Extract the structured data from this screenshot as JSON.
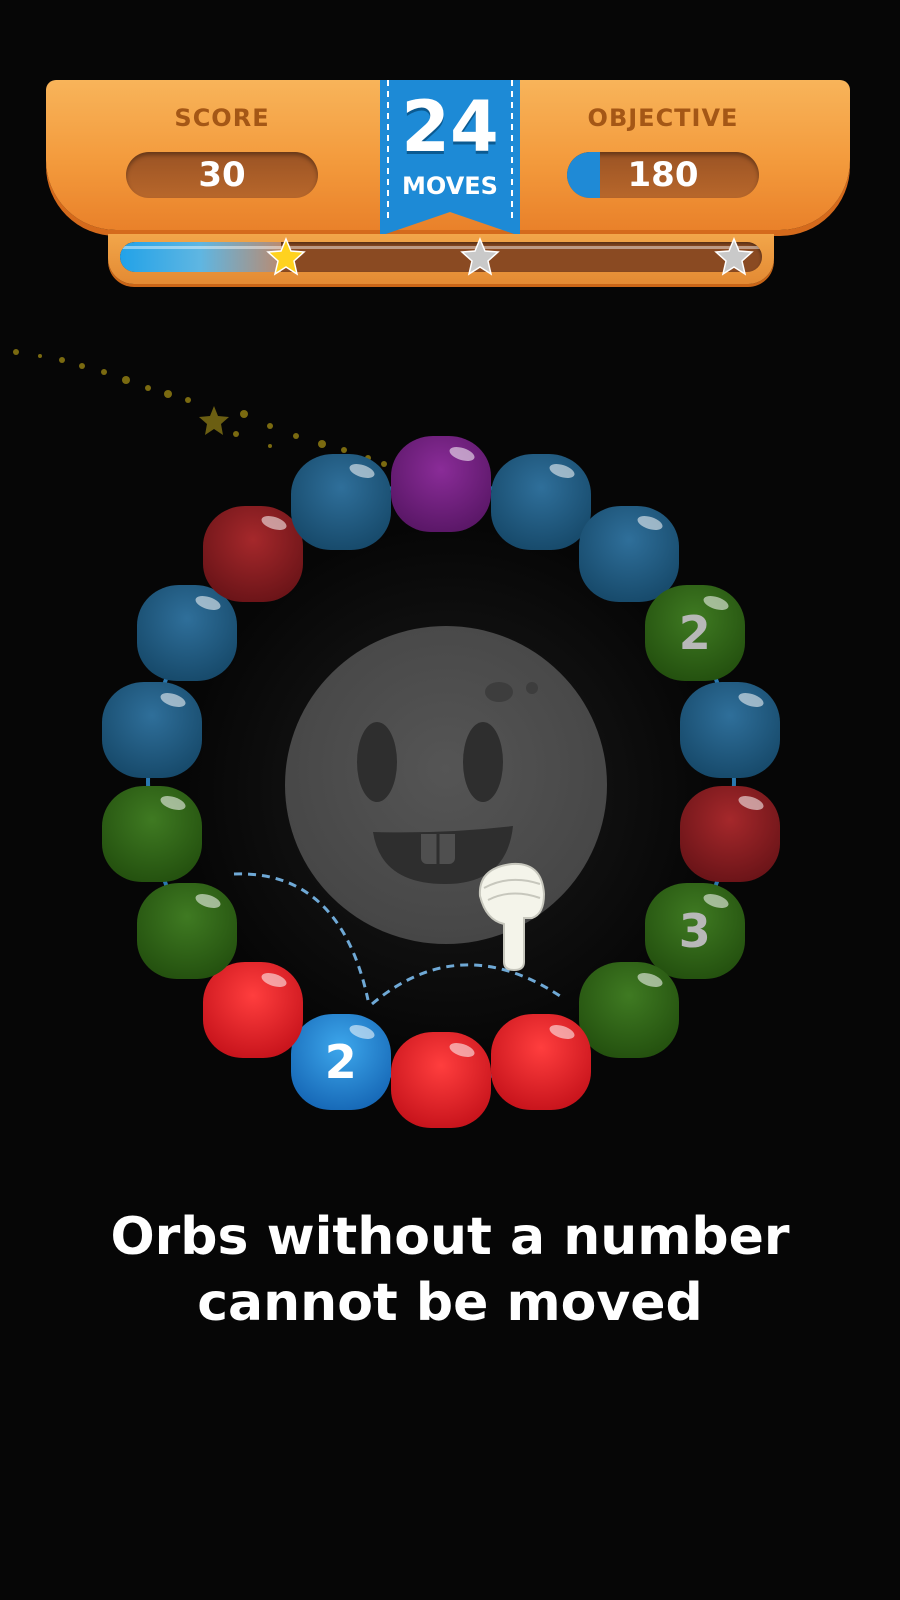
{
  "hud": {
    "score_label": "SCORE",
    "score_value": "30",
    "moves_count": "24",
    "moves_label": "MOVES",
    "objective_label": "OBJECTIVE",
    "objective_value": "180",
    "objective_progress": 0.17,
    "star_progress": 0.25,
    "stars": [
      {
        "name": "star-1",
        "earned": true
      },
      {
        "name": "star-2",
        "earned": false
      },
      {
        "name": "star-3",
        "earned": false
      }
    ]
  },
  "board": {
    "orbs": [
      {
        "color": "purple",
        "number": ""
      },
      {
        "color": "blue-dim",
        "number": ""
      },
      {
        "color": "blue-dim",
        "number": ""
      },
      {
        "color": "green-dim",
        "number": "2"
      },
      {
        "color": "blue-dim",
        "number": ""
      },
      {
        "color": "red-dim",
        "number": ""
      },
      {
        "color": "green-dim",
        "number": "3"
      },
      {
        "color": "green-dim",
        "number": ""
      },
      {
        "color": "red",
        "number": ""
      },
      {
        "color": "red",
        "number": ""
      },
      {
        "color": "blue",
        "number": "2"
      },
      {
        "color": "red",
        "number": ""
      },
      {
        "color": "green-dim",
        "number": ""
      },
      {
        "color": "green-dim",
        "number": ""
      },
      {
        "color": "blue-dim",
        "number": ""
      },
      {
        "color": "blue-dim",
        "number": ""
      },
      {
        "color": "red-dim",
        "number": ""
      },
      {
        "color": "blue-dim",
        "number": ""
      }
    ]
  },
  "tutorial": {
    "line1": "Orbs without a number",
    "line2": "cannot be moved"
  },
  "colors": {
    "hud_orange": "#f39a3c",
    "ribbon_blue": "#1f8ad6",
    "star_gold": "#ffd21f",
    "star_grey": "#c9c9c9"
  }
}
